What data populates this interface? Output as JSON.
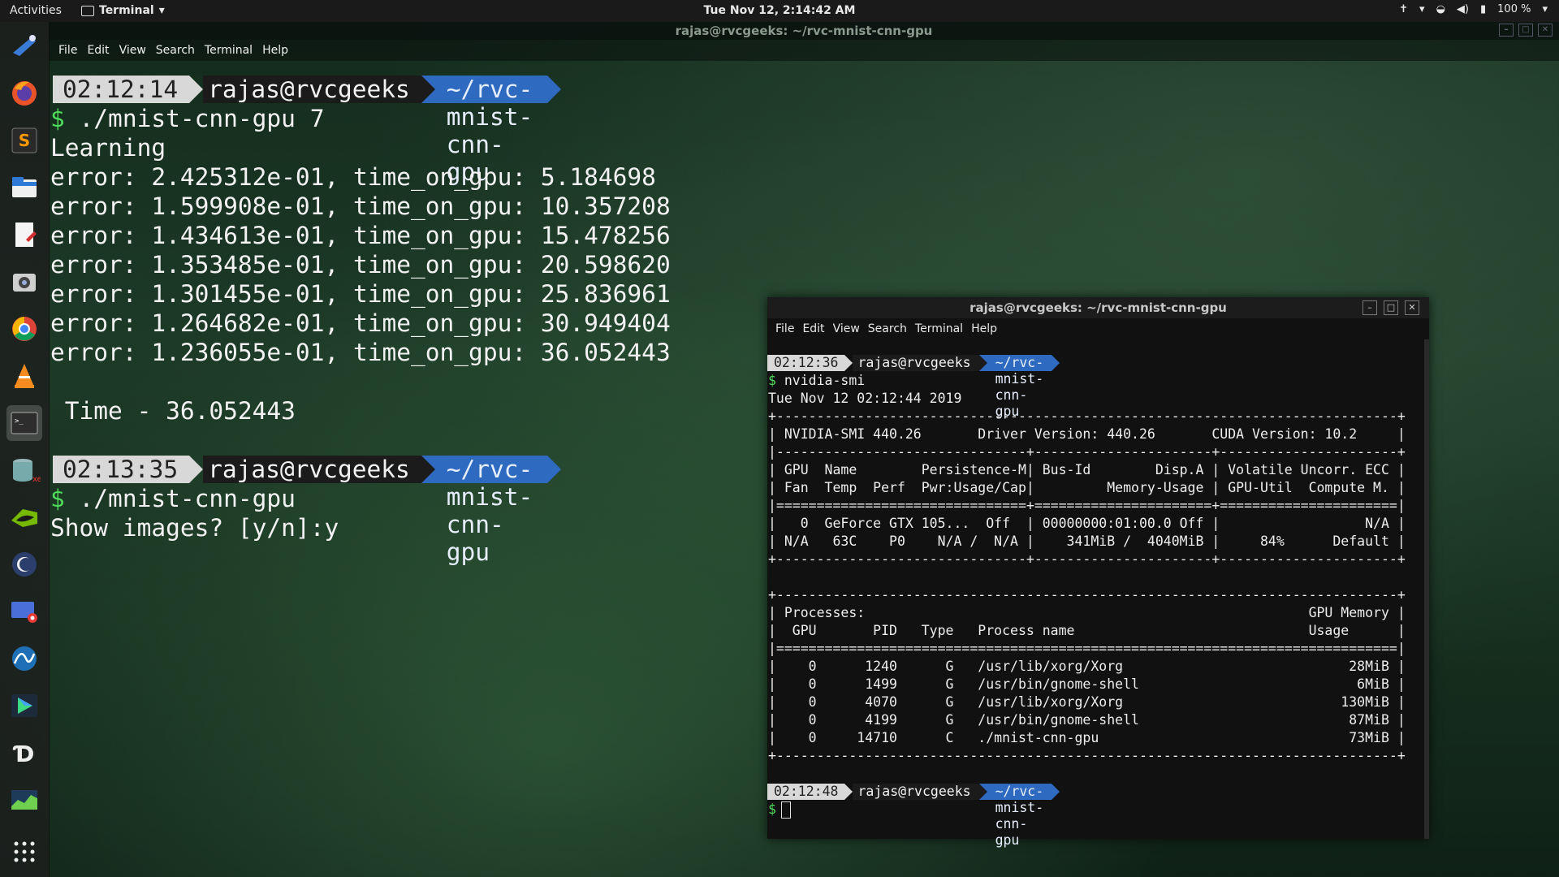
{
  "topbar": {
    "activities": "Activities",
    "app_name": "Terminal",
    "clock": "Tue Nov 12,  2:14:42 AM",
    "battery": "100 %"
  },
  "dock": {
    "items": [
      "thunderbird-icon",
      "firefox-icon",
      "sublime-text-icon",
      "files-icon",
      "text-editor-icon",
      "camera-icon",
      "chrome-icon",
      "vlc-icon",
      "terminal-icon",
      "database-icon",
      "nvidia-icon",
      "eclipse-icon",
      "screen-recorder-icon",
      "wireshark-icon",
      "android-studio-icon",
      "dbeaver-icon",
      "system-monitor-icon",
      "show-apps-icon"
    ]
  },
  "main_terminal": {
    "title": "rajas@rvcgeeks: ~/rvc-mnist-cnn-gpu",
    "menu": [
      "File",
      "Edit",
      "View",
      "Search",
      "Terminal",
      "Help"
    ],
    "prompt1": {
      "time": "02:12:14",
      "user": "rajas@rvcgeeks",
      "path": "~/rvc-mnist-cnn-gpu"
    },
    "command1": "./mnist-cnn-gpu 7",
    "dollar": "$",
    "output": [
      "Learning",
      "error: 2.425312e-01, time_on_gpu: 5.184698",
      "error: 1.599908e-01, time_on_gpu: 10.357208",
      "error: 1.434613e-01, time_on_gpu: 15.478256",
      "error: 1.353485e-01, time_on_gpu: 20.598620",
      "error: 1.301455e-01, time_on_gpu: 25.836961",
      "error: 1.264682e-01, time_on_gpu: 30.949404",
      "error: 1.236055e-01, time_on_gpu: 36.052443"
    ],
    "time_line": " Time - 36.052443",
    "prompt2": {
      "time": "02:13:35",
      "user": "rajas@rvcgeeks",
      "path": "~/rvc-mnist-cnn-gpu"
    },
    "command2": "./mnist-cnn-gpu",
    "show_images": "Show images? [y/n]:y"
  },
  "second_terminal": {
    "title": "rajas@rvcgeeks: ~/rvc-mnist-cnn-gpu",
    "menu": [
      "File",
      "Edit",
      "View",
      "Search",
      "Terminal",
      "Help"
    ],
    "prompt1": {
      "time": "02:12:36",
      "user": "rajas@rvcgeeks",
      "path": "~/rvc-mnist-cnn-gpu"
    },
    "command": "nvidia-smi",
    "dollar": "$",
    "lines": [
      "Tue Nov 12 02:12:44 2019",
      "+-----------------------------------------------------------------------------+",
      "| NVIDIA-SMI 440.26       Driver Version: 440.26       CUDA Version: 10.2     |",
      "|-------------------------------+----------------------+----------------------+",
      "| GPU  Name        Persistence-M| Bus-Id        Disp.A | Volatile Uncorr. ECC |",
      "| Fan  Temp  Perf  Pwr:Usage/Cap|         Memory-Usage | GPU-Util  Compute M. |",
      "|===============================+======================+======================|",
      "|   0  GeForce GTX 105...  Off  | 00000000:01:00.0 Off |                  N/A |",
      "| N/A   63C    P0    N/A /  N/A |    341MiB /  4040MiB |     84%      Default |",
      "+-------------------------------+----------------------+----------------------+",
      "",
      "+-----------------------------------------------------------------------------+",
      "| Processes:                                                       GPU Memory |",
      "|  GPU       PID   Type   Process name                             Usage      |",
      "|=============================================================================|",
      "|    0      1240      G   /usr/lib/xorg/Xorg                            28MiB |",
      "|    0      1499      G   /usr/bin/gnome-shell                           6MiB |",
      "|    0      4070      G   /usr/lib/xorg/Xorg                           130MiB |",
      "|    0      4199      G   /usr/bin/gnome-shell                          87MiB |",
      "|    0     14710      C   ./mnist-cnn-gpu                               73MiB |",
      "+-----------------------------------------------------------------------------+"
    ],
    "prompt2": {
      "time": "02:12:48",
      "user": "rajas@rvcgeeks",
      "path": "~/rvc-mnist-cnn-gpu"
    }
  }
}
